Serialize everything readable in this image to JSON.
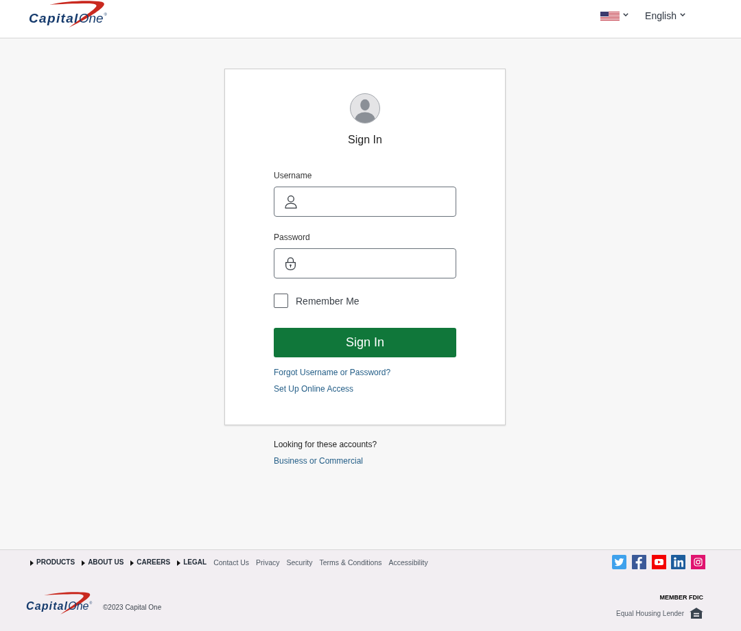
{
  "header": {
    "logo": "**Capital**One$^{®}$",
    "language": "English"
  },
  "sign_in": {
    "title": "Sign In",
    "fields": [
      {
        "label": "Username",
        "kind": "username"
      },
      {
        "label": "Password",
        "kind": "password"
      }
    ],
    "remember_me": {
      "label": "Remember Me",
      "checked": false
    },
    "submit": "Sign In",
    "links": [
      "Forgot Username or Password?",
      "Set Up Online Access"
    ]
  },
  "other_accounts": {
    "prompt": "Looking for these accounts?",
    "link": "Business or Commercial"
  },
  "footer": {
    "menus": [
      {
        "label": "PRODUCTS",
        "expanded": false
      },
      {
        "label": "ABOUT US",
        "expanded": false
      },
      {
        "label": "CAREERS",
        "expanded": false
      },
      {
        "label": "LEGAL",
        "expanded": false
      }
    ],
    "links": [
      "Contact Us",
      "Privacy",
      "Security",
      "Terms & Conditions",
      "Accessibility"
    ],
    "logo": "**Capital**One$^{®}$",
    "copyright": "©2023 Capital One",
    "fdic": "MEMBER FDIC",
    "housing": "Equal Housing Lender"
  }
}
